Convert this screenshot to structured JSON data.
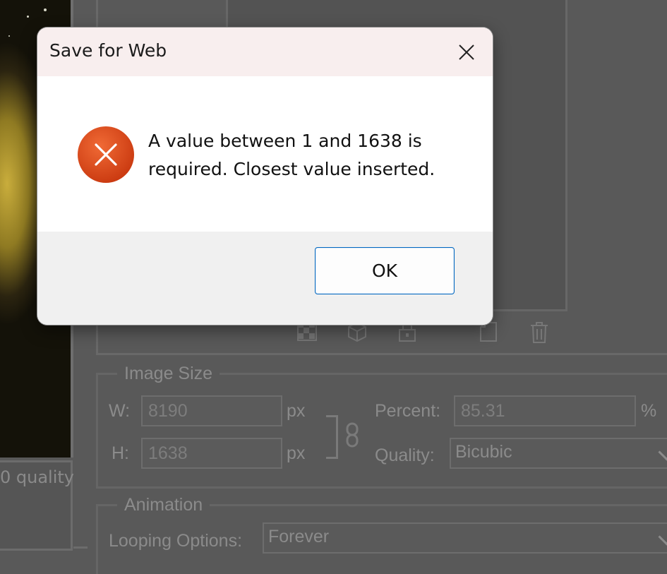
{
  "background": {
    "preview_caption": "0 quality",
    "image_size_group": {
      "title": "Image Size",
      "width_label": "W:",
      "width_value": "8190",
      "height_label": "H:",
      "height_value": "1638",
      "unit_px": "px",
      "percent_label": "Percent:",
      "percent_value": "85.31",
      "percent_unit": "%",
      "quality_label": "Quality:",
      "quality_value": "Bicubic"
    },
    "animation_group": {
      "title": "Animation",
      "looping_label": "Looping Options:",
      "looping_value": "Forever"
    },
    "toolbar_icons": [
      "checkerboard-icon",
      "cube-icon",
      "lock-icon",
      "new-page-icon",
      "trash-icon"
    ]
  },
  "dialog": {
    "title": "Save for Web",
    "message_line1": "A value between 1 and 1638 is",
    "message_line2": "required. Closest value inserted.",
    "icon": "error-icon",
    "ok_label": "OK",
    "colors": {
      "titlebar": "#f8eeee",
      "error": "#d8431b",
      "ok_border": "#0067c0"
    }
  }
}
